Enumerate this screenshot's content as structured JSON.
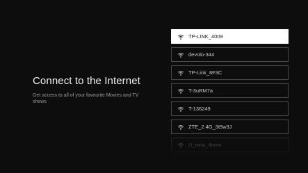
{
  "left": {
    "title": "Connect to the Internet",
    "subtitle": "Get access to all of your favourite Movies and TV shows"
  },
  "networks": [
    {
      "ssid": "TP-LINK_4009",
      "selected": true,
      "icon": "wifi-icon"
    },
    {
      "ssid": "devolo-344",
      "selected": false,
      "icon": "wifi-icon"
    },
    {
      "ssid": "TP-Link_8F3C",
      "selected": false,
      "icon": "wifi-icon"
    },
    {
      "ssid": "T-3uRM7a",
      "selected": false,
      "icon": "wifi-icon"
    },
    {
      "ssid": "T-136249",
      "selected": false,
      "icon": "wifi-icon"
    },
    {
      "ssid": "ZTE_2.4G_3t9w3J",
      "selected": false,
      "icon": "wifi-icon"
    },
    {
      "ssid": "U_mna_doma",
      "selected": false,
      "icon": "wifi-icon"
    }
  ],
  "colors": {
    "background": "#0d0d0e",
    "selected_background": "#ffffff",
    "item_border": "#4a4a4d",
    "title_text": "#f2f2f2",
    "subtitle_text": "#9a9a9c"
  }
}
